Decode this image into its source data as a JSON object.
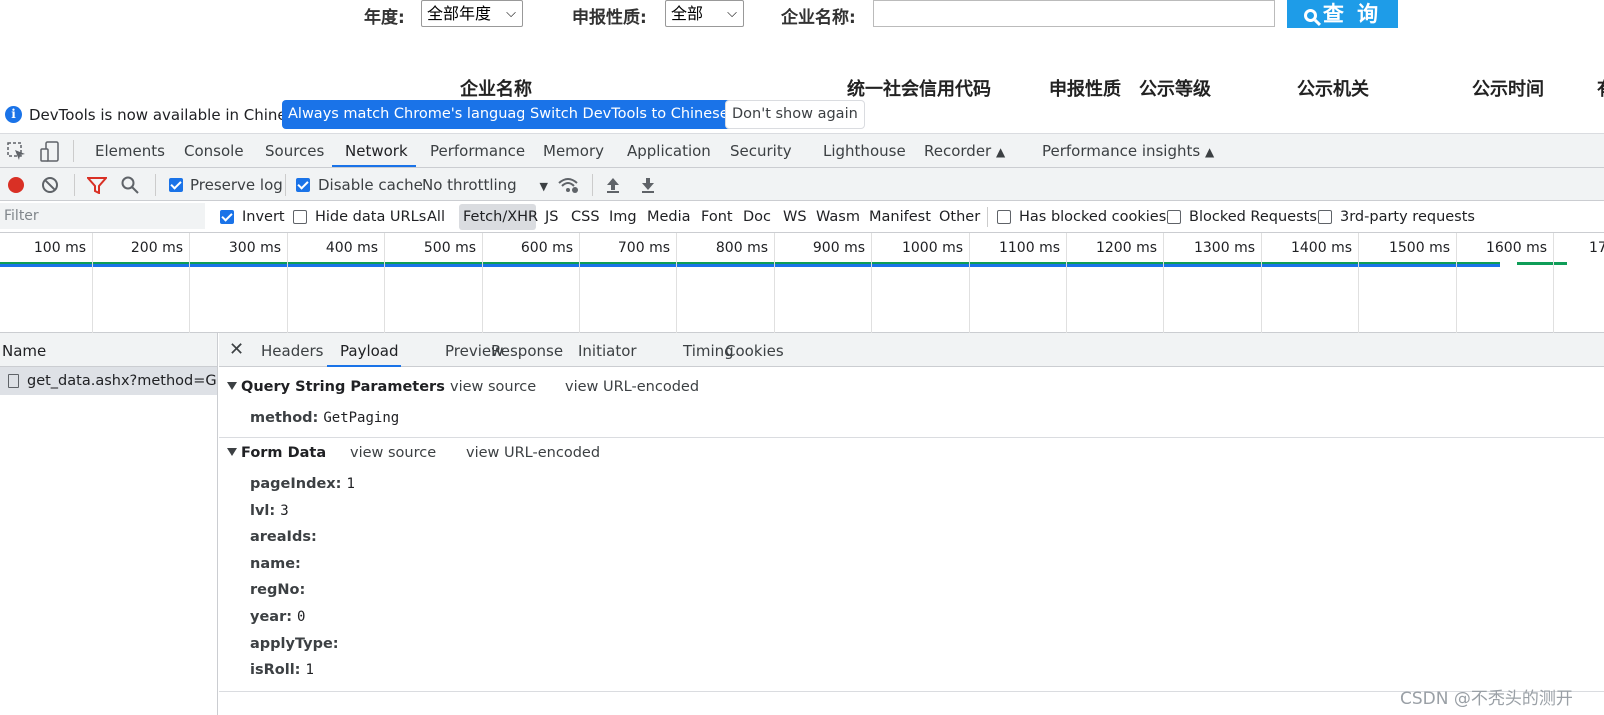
{
  "page": {
    "filters": [
      {
        "label": "年度:",
        "value": "全部年度"
      },
      {
        "label": "申报性质:",
        "value": "全部"
      },
      {
        "label": "企业名称:",
        "value": ""
      }
    ],
    "query_button": "查 询",
    "column_headers": [
      "企业名称",
      "统一社会信用代码",
      "申报性质",
      "公示等级",
      "公示机关",
      "公示时间",
      "有"
    ]
  },
  "infobar": {
    "message": "DevTools is now available in Chinese!",
    "buttons": [
      "Always match Chrome's language",
      "Switch DevTools to Chinese",
      "Don't show again"
    ]
  },
  "devtools_tabs": [
    "Elements",
    "Console",
    "Sources",
    "Network",
    "Performance",
    "Memory",
    "Application",
    "Security",
    "Lighthouse",
    "Recorder",
    "Performance insights"
  ],
  "devtools_active_tab": "Network",
  "network_toolbar": {
    "preserve_log": {
      "label": "Preserve log",
      "checked": true
    },
    "disable_cache": {
      "label": "Disable cache",
      "checked": true
    },
    "throttling": "No throttling"
  },
  "filter_bar": {
    "placeholder": "Filter",
    "invert": {
      "label": "Invert",
      "checked": true
    },
    "hide_data_urls": {
      "label": "Hide data URLs",
      "checked": false
    },
    "types": [
      "All",
      "Fetch/XHR",
      "JS",
      "CSS",
      "Img",
      "Media",
      "Font",
      "Doc",
      "WS",
      "Wasm",
      "Manifest",
      "Other"
    ],
    "active_type": "Fetch/XHR",
    "has_blocked_cookies": {
      "label": "Has blocked cookies",
      "checked": false
    },
    "blocked_requests": {
      "label": "Blocked Requests",
      "checked": false
    },
    "third_party": {
      "label": "3rd-party requests",
      "checked": false
    }
  },
  "timeline": {
    "ticks": [
      "100 ms",
      "200 ms",
      "300 ms",
      "400 ms",
      "500 ms",
      "600 ms",
      "700 ms",
      "800 ms",
      "900 ms",
      "1000 ms",
      "1100 ms",
      "1200 ms",
      "1300 ms",
      "1400 ms",
      "1500 ms",
      "1600 ms",
      "17"
    ]
  },
  "requests": {
    "column": "Name",
    "rows": [
      "get_data.ashx?method=G..."
    ]
  },
  "detail_tabs": [
    "Headers",
    "Payload",
    "Preview",
    "Response",
    "Initiator",
    "Timing",
    "Cookies"
  ],
  "detail_active_tab": "Payload",
  "payload": {
    "query_string": {
      "title": "Query String Parameters",
      "view_source": "view source",
      "view_encoded": "view URL-encoded",
      "params": [
        {
          "key": "method:",
          "value": "GetPaging"
        }
      ]
    },
    "form_data": {
      "title": "Form Data",
      "view_source": "view source",
      "view_encoded": "view URL-encoded",
      "params": [
        {
          "key": "pageIndex:",
          "value": "1"
        },
        {
          "key": "lvl:",
          "value": "3"
        },
        {
          "key": "areaIds:",
          "value": ""
        },
        {
          "key": "name:",
          "value": ""
        },
        {
          "key": "regNo:",
          "value": ""
        },
        {
          "key": "year:",
          "value": "0"
        },
        {
          "key": "applyType:",
          "value": ""
        },
        {
          "key": "isRoll:",
          "value": "1"
        }
      ]
    }
  },
  "watermark": "CSDN @不秃头的测开",
  "colors": {
    "accent": "#1a73e8",
    "query_button": "#1e9ce8",
    "record": "#d93025",
    "waterfall_green": "#0f9d58"
  }
}
